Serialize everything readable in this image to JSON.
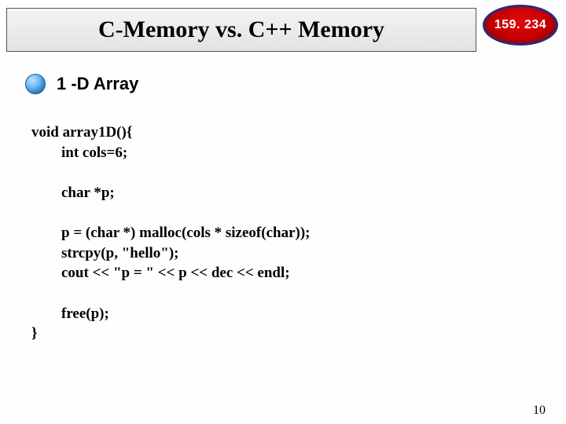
{
  "header": {
    "title": "C-Memory vs. C++ Memory",
    "badge": "159. 234"
  },
  "bullet": {
    "label": "1 -D Array"
  },
  "code": {
    "line0": "void array1D(){",
    "line1": "        int cols=6;",
    "blank1": "",
    "line2": "        char *p;",
    "blank2": "",
    "line3": "        p = (char *) malloc(cols * sizeof(char));",
    "line4": "        strcpy(p, \"hello\");",
    "line5": "        cout << \"p = \" << p << dec << endl;",
    "blank3": "",
    "line6": "        free(p);",
    "line7": "}"
  },
  "page_number": "10"
}
